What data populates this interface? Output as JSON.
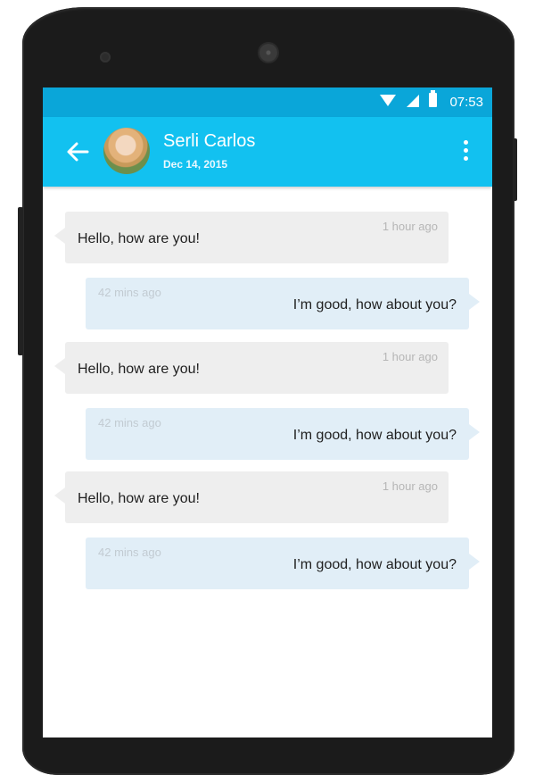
{
  "status_bar": {
    "time": "07:53"
  },
  "header": {
    "contact_name": "Serli Carlos",
    "contact_date": "Dec 14, 2015",
    "back_icon": "arrow-back-icon",
    "menu_icon": "more-vert-icon"
  },
  "messages": [
    {
      "direction": "incoming",
      "text": "Hello, how are you!",
      "time": "1 hour ago"
    },
    {
      "direction": "outgoing",
      "text": "I’m good, how about you?",
      "time": "42 mins ago"
    },
    {
      "direction": "incoming",
      "text": "Hello, how are you!",
      "time": "1 hour ago"
    },
    {
      "direction": "outgoing",
      "text": "I’m good, how about you?",
      "time": "42 mins ago"
    },
    {
      "direction": "incoming",
      "text": "Hello, how are you!",
      "time": "1 hour ago"
    },
    {
      "direction": "outgoing",
      "text": "I’m good, how about you?",
      "time": "42 mins ago"
    }
  ],
  "colors": {
    "status_bar": "#0aa6d9",
    "app_bar": "#12c1f0",
    "incoming_bubble": "#eeeeee",
    "outgoing_bubble": "#e1eef7"
  }
}
